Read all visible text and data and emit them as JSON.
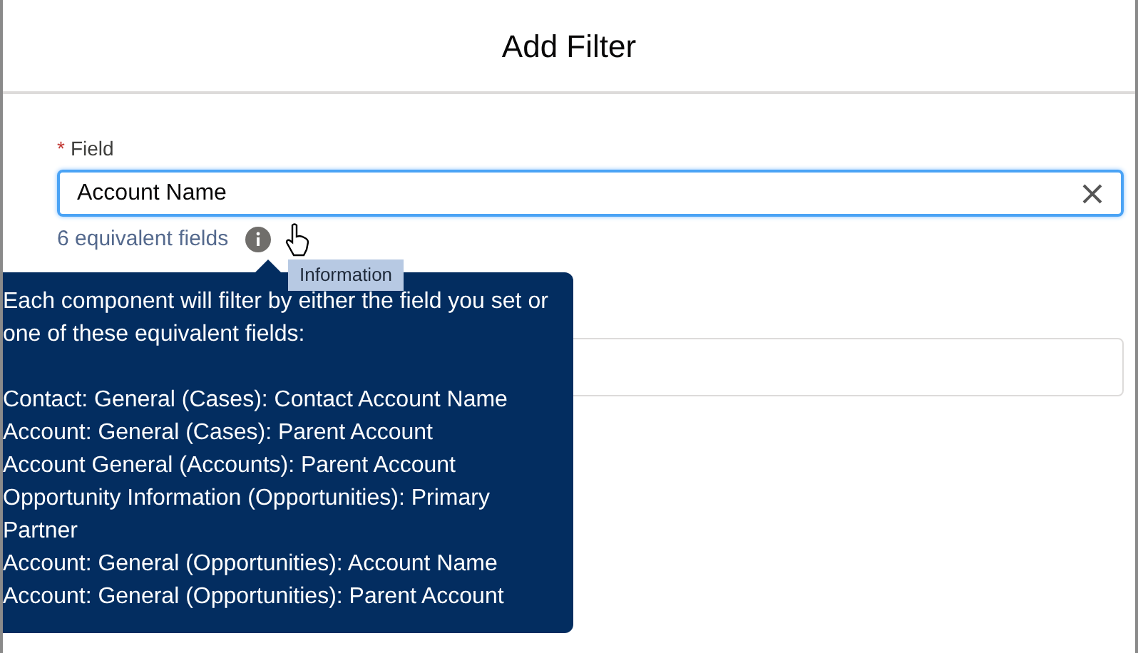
{
  "dialog": {
    "title": "Add Filter"
  },
  "field": {
    "label": "Field",
    "required": true,
    "required_mark": "*",
    "value": "Account Name",
    "helper": "6 equivalent fields"
  },
  "tooltip": {
    "text": "Information"
  },
  "popover": {
    "intro": "Each component will filter by either the field you set or one of these equivalent fields:",
    "items": [
      "Contact: General (Cases): Contact Account Name",
      "Account: General (Cases): Parent Account",
      "Account General (Accounts): Parent Account",
      "Opportunity Information (Opportunities): Primary Partner",
      "Account: General (Opportunities): Account Name",
      "Account: General (Opportunities): Parent Account"
    ]
  }
}
